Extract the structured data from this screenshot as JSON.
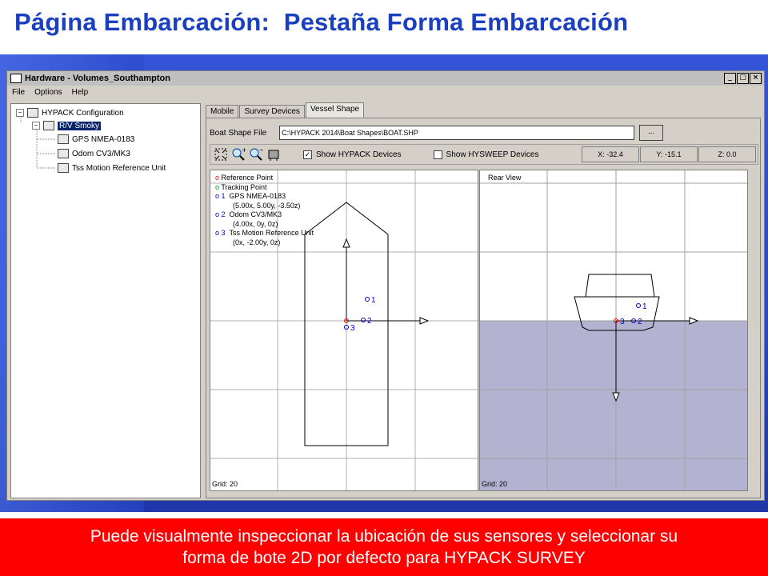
{
  "slide_title": "Página Embarcación:  Pestaña Forma Embarcación",
  "caption_line1": "Puede visualmente inspeccionar la ubicación de sus sensores y seleccionar su",
  "caption_line2": "forma de bote 2D por defecto para HYPACK SURVEY",
  "window": {
    "title": "Hardware - Volumes_Southampton",
    "min_btn": "_",
    "max_btn": "□",
    "close_btn": "×"
  },
  "menu": [
    "File",
    "Options",
    "Help"
  ],
  "tree": {
    "root": "HYPACK Configuration",
    "vessel": "R/V Smoky",
    "devices": [
      "GPS NMEA-0183",
      "Odom CV3/MK3",
      "Tss Motion Reference Unit"
    ]
  },
  "tabs": [
    "Mobile",
    "Survey Devices",
    "Vessel Shape"
  ],
  "vessel_shape": {
    "boat_file_label": "Boat Shape File",
    "boat_file_path": "C:\\HYPACK 2014\\Boat Shapes\\BOAT.SHP",
    "browse_label": "...",
    "show_hypack_label": "Show HYPACK Devices",
    "show_hypack_checked": true,
    "show_hypack_mark": "✓",
    "show_hysweep_label": "Show HYSWEEP Devices",
    "show_hysweep_checked": false,
    "coord_x": "X: -32.4",
    "coord_y": "Y: -15.1",
    "coord_z": "Z: 0.0"
  },
  "legend": {
    "reference": "Reference Point",
    "tracking": "Tracking Point",
    "dev1_num": "1",
    "dev1_name": "GPS NMEA-0183",
    "dev1_offset": "(5.00x, 5.00y, -3.50z)",
    "dev2_num": "2",
    "dev2_name": "Odom CV3/MK3",
    "dev2_offset": "(4.00x, 0y, 0z)",
    "dev3_num": "3",
    "dev3_name": "Tss Motion Reference Unit",
    "dev3_offset": "(0x, -2.00y, 0z)"
  },
  "top_view": {
    "grid_label": "Grid: 20",
    "labels": [
      "1",
      "2",
      "3"
    ]
  },
  "rear_view": {
    "title": "Rear View",
    "grid_label": "Grid: 20",
    "labels": [
      "1",
      "2",
      "3"
    ]
  },
  "colors": {
    "title_blue": "#1a3fbf",
    "caption_red": "#ff0000",
    "water": "#b3b3d1",
    "reference_point": "#ff0000",
    "tracking_point": "#00a000",
    "device": "#0000cc"
  }
}
